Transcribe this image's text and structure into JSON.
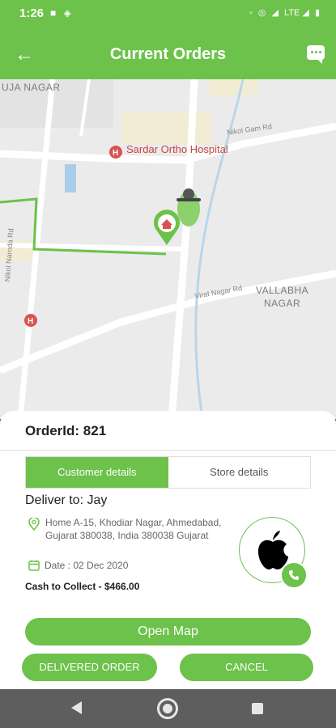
{
  "status_bar": {
    "time": "1:26",
    "left_icons": [
      "notification-square-icon",
      "location-diamond-icon"
    ],
    "right_text": "LTE",
    "right_icons": [
      "no-sim-icon",
      "hotspot-icon",
      "signal-icon",
      "battery-icon"
    ]
  },
  "app_bar": {
    "title": "Current Orders",
    "back_icon": "arrow-left-icon",
    "chat_icon": "chat-bubble-icon"
  },
  "map": {
    "area_labels": {
      "top_left": "UJA NAGAR",
      "vallabha_line1": "VALLABHA",
      "vallabha_line2": "NAGAR"
    },
    "poi": {
      "hospital": "Sardar Ortho Hospital"
    },
    "road_labels": {
      "nikol": "Nikol Gam Rd",
      "virat": "Virat Nagar Rd",
      "left_road": "Nikol Naroda Rd"
    }
  },
  "order": {
    "id_label": "OrderId: 821",
    "tabs": [
      {
        "label": "Customer details",
        "active": true
      },
      {
        "label": "Store details",
        "active": false
      }
    ],
    "deliver_to": "Deliver to: Jay",
    "address": "Home A-15, Khodiar Nagar, Ahmedabad, Gujarat 380038, India 380038 Gujarat",
    "date": "Date : 02 Dec 2020",
    "cash": "Cash to Collect - $466.00"
  },
  "actions": {
    "open_map": "Open Map",
    "delivered": "DELIVERED ORDER",
    "cancel": "CANCEL"
  },
  "colors": {
    "brand": "#6cc24a",
    "hospital_red": "#c7463e",
    "nav_bar": "#5e5e5e"
  }
}
